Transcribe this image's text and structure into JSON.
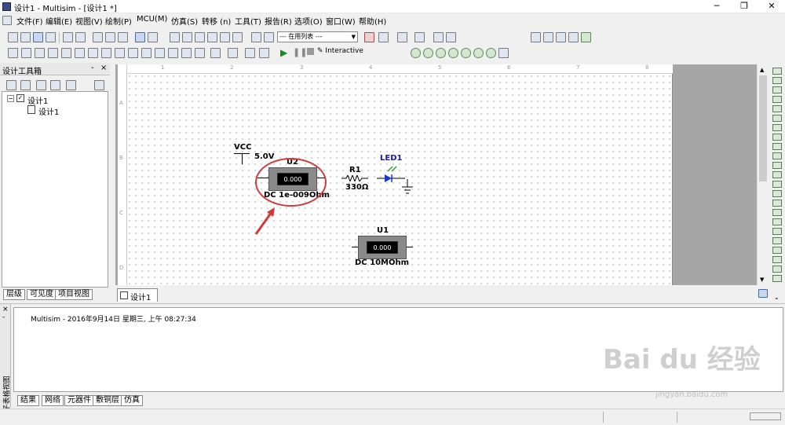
{
  "window": {
    "title": "设计1 - Multisim - [设计1 *]",
    "min": "─",
    "restore": "❐",
    "close": "✕"
  },
  "menu": [
    "文件(F)",
    "编辑(E)",
    "视图(V)",
    "绘制(P)",
    "MCU(M)",
    "仿真(S)",
    "转移 (n)",
    "工具(T)",
    "报告(R)",
    "选项(O)",
    "窗口(W)",
    "帮助(H)"
  ],
  "toolbar": {
    "in_use_list": "--- 在用列表 ---",
    "interactive": "Interactive"
  },
  "design_toolbox": {
    "title": "设计工具箱",
    "close": "×",
    "pin": "-",
    "root": "设计1",
    "child": "设计1",
    "tabs": [
      "层级",
      "可见度",
      "项目视图"
    ]
  },
  "schematic": {
    "vcc_label": "VCC",
    "vcc_value": "5.0V",
    "u2_label": "U2",
    "u2_display": "0.000",
    "u2_value": "DC  1e-009Ohm",
    "r1_label": "R1",
    "r1_value": "330Ω",
    "led_label": "LED1",
    "u1_label": "U1",
    "u1_display": "0.000",
    "u1_value": "DC  10MOhm",
    "ruler_top": [
      "1",
      "2",
      "3",
      "4",
      "5",
      "6",
      "7",
      "8"
    ],
    "ruler_left": [
      "A",
      "B",
      "C",
      "D"
    ]
  },
  "doc_tab": "设计1 *",
  "output": {
    "side_label": "电子表格视图",
    "message": "Multisim  -  2016年9月14日 星期三, 上午 08:27:34",
    "tabs": [
      "结果",
      "网络",
      "元器件",
      "敷铜层",
      "仿真"
    ]
  },
  "watermark": {
    "text": "Bai du 经验",
    "url": "jingyan.baidu.com"
  },
  "colors": {
    "led_label": "#1a1aa8",
    "led": "#1a3ad8",
    "annotation": "#d03a3a",
    "arrow": "#d03a3a"
  }
}
